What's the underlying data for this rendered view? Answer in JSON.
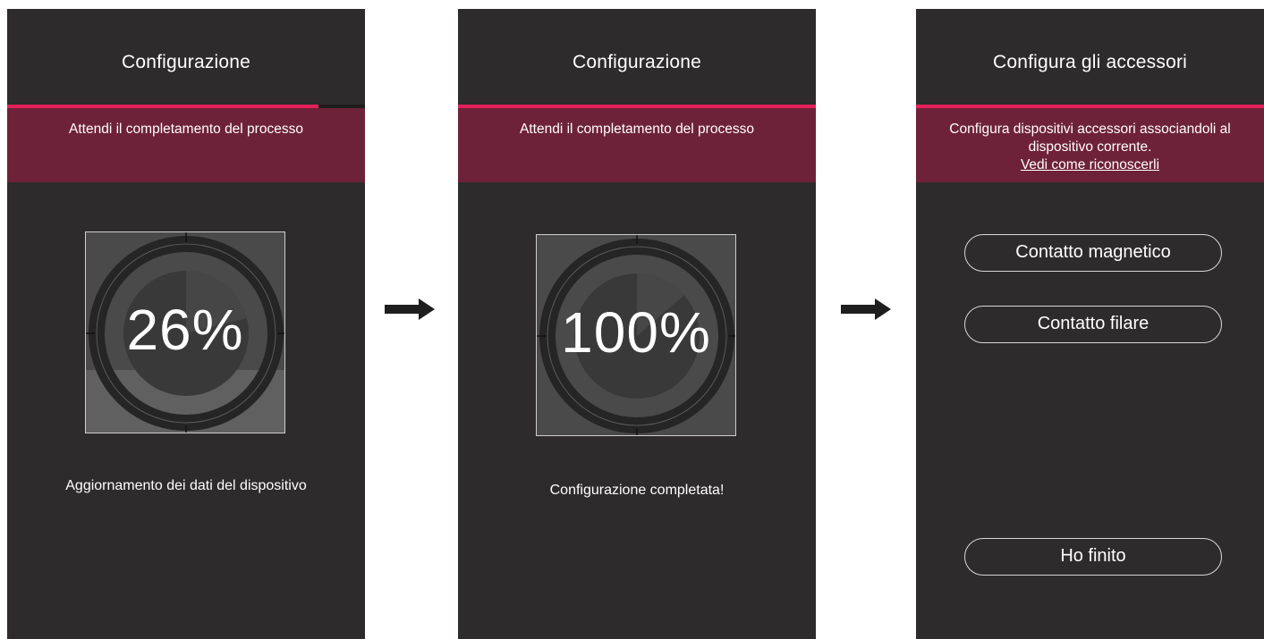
{
  "screens": [
    {
      "title": "Configurazione",
      "progress_fraction": 0.87,
      "banner_text": "Attendi il completamento del processo",
      "percent_label": "26%",
      "percent_value": 26,
      "status": "Aggiornamento dei dati del dispositivo"
    },
    {
      "title": "Configurazione",
      "progress_fraction": 1.0,
      "banner_text": "Attendi il completamento del processo",
      "percent_label": "100%",
      "percent_value": 100,
      "status": "Configurazione completata!"
    },
    {
      "title": "Configura gli accessori",
      "progress_fraction": 1.0,
      "banner_line1": "Configura dispositivi accessori associandoli al",
      "banner_line2": "dispositivo corrente.",
      "banner_link": "Vedi come riconoscerli",
      "buttons": {
        "magnetic": "Contatto magnetico",
        "wired": "Contatto filare",
        "done": "Ho finito"
      }
    }
  ],
  "icons": {
    "arrow_1": "arrow-right-icon",
    "arrow_2": "arrow-right-icon"
  },
  "colors": {
    "screen_bg": "#2d2b2c",
    "accent": "#e5215a",
    "banner_bg": "#6e2239",
    "dial_bg": "#4b4a4b"
  }
}
